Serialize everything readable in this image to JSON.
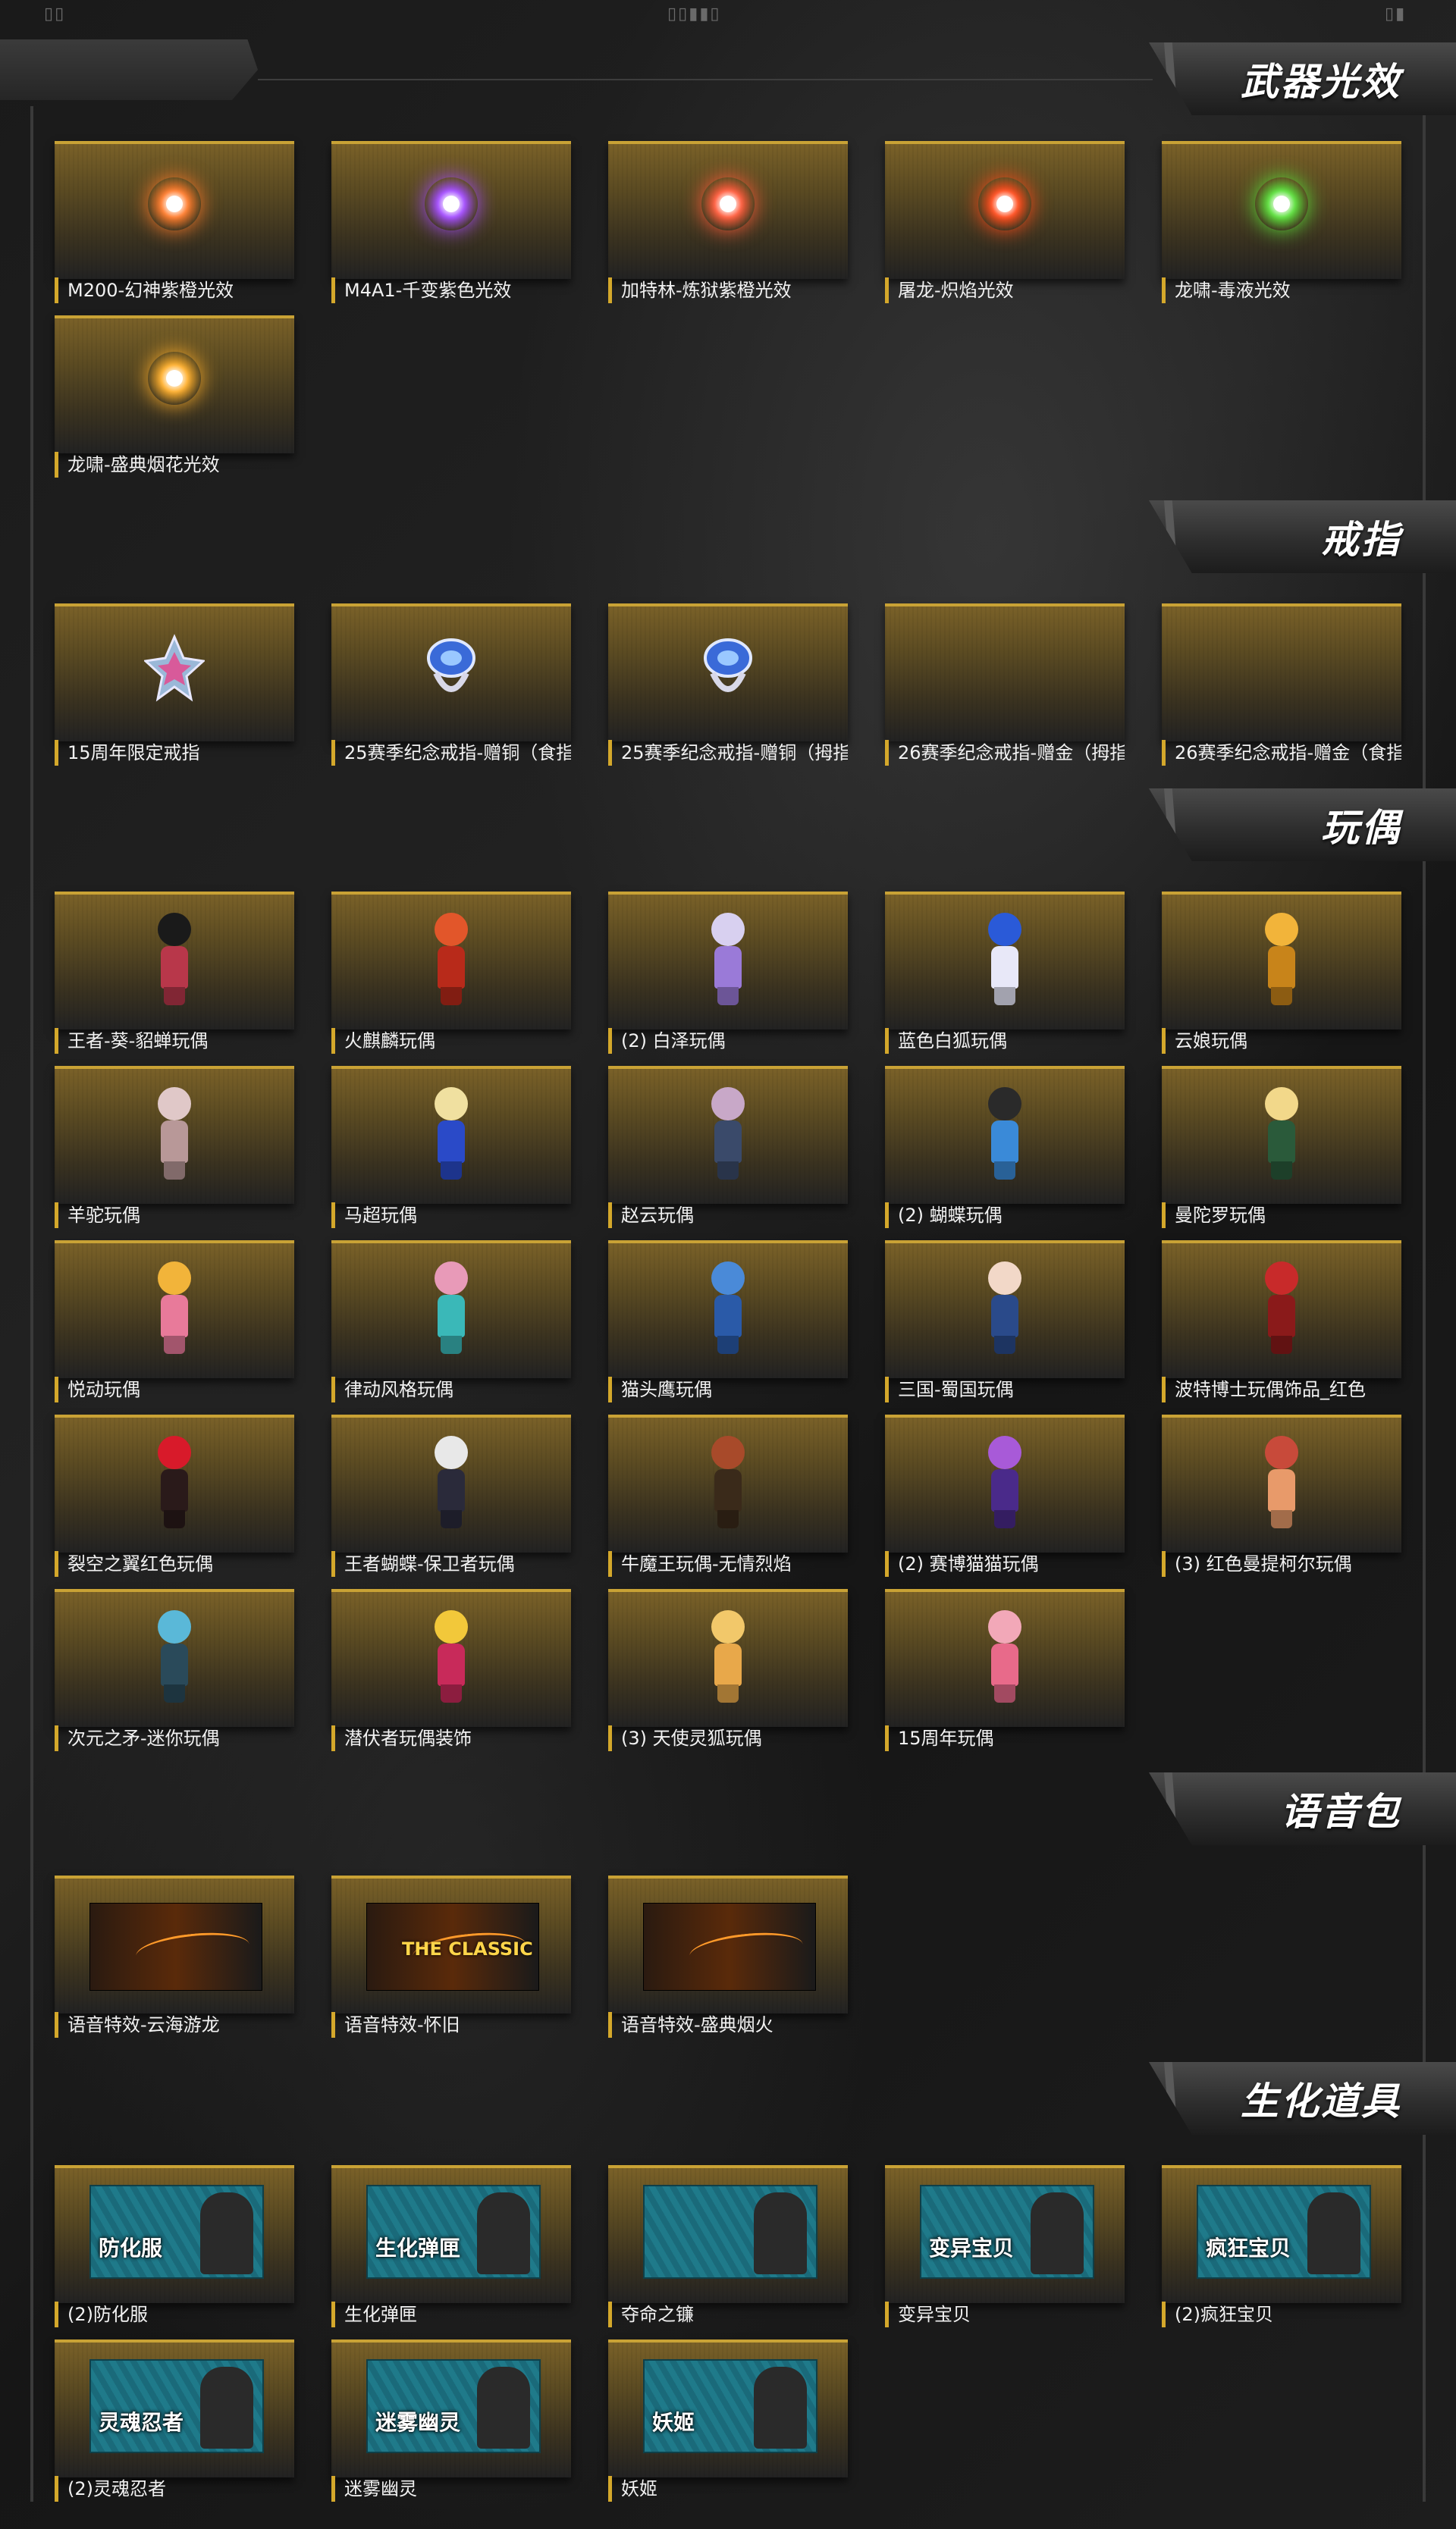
{
  "topbar": {
    "left_glyph": "▯▯",
    "mid_glyph": "▯▯▮▮▯",
    "right_glyph": "▯▮"
  },
  "colors": {
    "accent_gold": "#c9a235",
    "label_bar": "#d4a82b"
  },
  "sections": {
    "weapon_effects": {
      "title": "武器光效",
      "items": [
        {
          "label": "M200-幻神紫橙光效",
          "icon": "orb-orange-purple-icon",
          "color": "#ff7a2a"
        },
        {
          "label": "M4A1-千变紫色光效",
          "icon": "orb-purple-icon",
          "color": "#a24aff"
        },
        {
          "label": "加特林-炼狱紫橙光效",
          "icon": "orb-red-orange-icon",
          "color": "#ff5a3a"
        },
        {
          "label": "屠龙-炽焰光效",
          "icon": "orb-flame-icon",
          "color": "#ff4a1a"
        },
        {
          "label": "龙啸-毒液光效",
          "icon": "orb-green-icon",
          "color": "#5adf3a"
        },
        {
          "label": "龙啸-盛典烟花光效",
          "icon": "orb-gold-icon",
          "color": "#ffae2a"
        }
      ]
    },
    "rings": {
      "title": "戒指",
      "items": [
        {
          "label": "15周年限定戒指",
          "icon": "star-ring-icon"
        },
        {
          "label": "25赛季纪念戒指-赠铜（食指",
          "icon": "blue-ring-icon"
        },
        {
          "label": "25赛季纪念戒指-赠铜（拇指",
          "icon": "blue-ring-icon"
        },
        {
          "label": "26赛季纪念戒指-赠金（拇指",
          "icon": ""
        },
        {
          "label": "26赛季纪念戒指-赠金（食指",
          "icon": ""
        }
      ]
    },
    "dolls": {
      "title": "玩偶",
      "items": [
        {
          "label": "王者-葵-貂蝉玩偶",
          "icon": "doll-icon",
          "c1": "#1a1a1a",
          "c2": "#b8374a"
        },
        {
          "label": "火麒麟玩偶",
          "icon": "doll-icon",
          "c1": "#e2562a",
          "c2": "#b82a1a"
        },
        {
          "label": "(2) 白泽玩偶",
          "icon": "doll-icon",
          "c1": "#d8d0f0",
          "c2": "#9a7ad8"
        },
        {
          "label": "蓝色白狐玩偶",
          "icon": "doll-icon",
          "c1": "#2a5ad8",
          "c2": "#e8e8f8"
        },
        {
          "label": "云娘玩偶",
          "icon": "doll-icon",
          "c1": "#f2b43a",
          "c2": "#c8841a"
        },
        {
          "label": "羊驼玩偶",
          "icon": "doll-icon",
          "c1": "#e0c8c8",
          "c2": "#b89898"
        },
        {
          "label": "马超玩偶",
          "icon": "doll-icon",
          "c1": "#f0e0a0",
          "c2": "#2a4ac8"
        },
        {
          "label": "赵云玩偶",
          "icon": "doll-icon",
          "c1": "#c8a8c8",
          "c2": "#3a4a6a"
        },
        {
          "label": "(2) 蝴蝶玩偶",
          "icon": "doll-icon",
          "c1": "#2a2a2a",
          "c2": "#3a8ad8"
        },
        {
          "label": "曼陀罗玩偶",
          "icon": "doll-icon",
          "c1": "#f2d88a",
          "c2": "#2a5a3a"
        },
        {
          "label": "悦动玩偶",
          "icon": "doll-icon",
          "c1": "#f2b43a",
          "c2": "#e87a9a"
        },
        {
          "label": "律动风格玩偶",
          "icon": "doll-icon",
          "c1": "#e89ab8",
          "c2": "#3ab8b8"
        },
        {
          "label": "猫头鹰玩偶",
          "icon": "doll-icon",
          "c1": "#4a8ad8",
          "c2": "#2a5aa8"
        },
        {
          "label": "三国-蜀国玩偶",
          "icon": "doll-icon",
          "c1": "#f2d8c8",
          "c2": "#2a4a8a"
        },
        {
          "label": "波特博士玩偶饰品_红色",
          "icon": "doll-icon",
          "c1": "#c82a2a",
          "c2": "#8a1a1a"
        },
        {
          "label": "裂空之翼红色玩偶",
          "icon": "doll-icon",
          "c1": "#d81a2a",
          "c2": "#2a1a1a"
        },
        {
          "label": "王者蝴蝶-保卫者玩偶",
          "icon": "doll-icon",
          "c1": "#e8e8e8",
          "c2": "#2a2a3a"
        },
        {
          "label": "牛魔王玩偶-无情烈焰",
          "icon": "doll-icon",
          "c1": "#a84a2a",
          "c2": "#3a2a1a"
        },
        {
          "label": "(2) 赛博猫猫玩偶",
          "icon": "doll-icon",
          "c1": "#a85ad8",
          "c2": "#4a2a8a"
        },
        {
          "label": "(3) 红色曼提柯尔玩偶",
          "icon": "doll-icon",
          "c1": "#c84a3a",
          "c2": "#e89a6a"
        },
        {
          "label": "次元之矛-迷你玩偶",
          "icon": "doll-icon",
          "c1": "#5ab8d8",
          "c2": "#2a4a5a"
        },
        {
          "label": "潜伏者玩偶装饰",
          "icon": "doll-icon",
          "c1": "#f2c83a",
          "c2": "#c82a5a"
        },
        {
          "label": "(3) 天使灵狐玩偶",
          "icon": "doll-icon",
          "c1": "#f2c86a",
          "c2": "#e8a84a"
        },
        {
          "label": "15周年玩偶",
          "icon": "doll-icon",
          "c1": "#f2a8b8",
          "c2": "#e86a8a"
        }
      ]
    },
    "voice_packs": {
      "title": "语音包",
      "items": [
        {
          "label": "语音特效-云海游龙",
          "icon": "dragon-voice-icon",
          "banner_text": ""
        },
        {
          "label": "语音特效-怀旧",
          "icon": "classic-voice-icon",
          "banner_text": "THE CLASSIC"
        },
        {
          "label": "语音特效-盛典烟火",
          "icon": "firework-voice-icon",
          "banner_text": ""
        }
      ]
    },
    "bio_items": {
      "title": "生化道具",
      "items": [
        {
          "label": "(2)防化服",
          "icon": "hazmat-suit-icon",
          "banner_text": "防化服"
        },
        {
          "label": "生化弹匣",
          "icon": "bio-magazine-icon",
          "banner_text": "生化弹匣"
        },
        {
          "label": "夺命之镰",
          "icon": "scythe-icon",
          "banner_text": ""
        },
        {
          "label": "变异宝贝",
          "icon": "mutant-baby-icon",
          "banner_text": "变异宝贝"
        },
        {
          "label": "(2)疯狂宝贝",
          "icon": "crazy-baby-icon",
          "banner_text": "疯狂宝贝"
        },
        {
          "label": "(2)灵魂忍者",
          "icon": "soul-ninja-icon",
          "banner_text": "灵魂忍者"
        },
        {
          "label": "迷雾幽灵",
          "icon": "mist-ghost-icon",
          "banner_text": "迷雾幽灵"
        },
        {
          "label": "妖姬",
          "icon": "enchantress-icon",
          "banner_text": "妖姬"
        }
      ]
    }
  }
}
